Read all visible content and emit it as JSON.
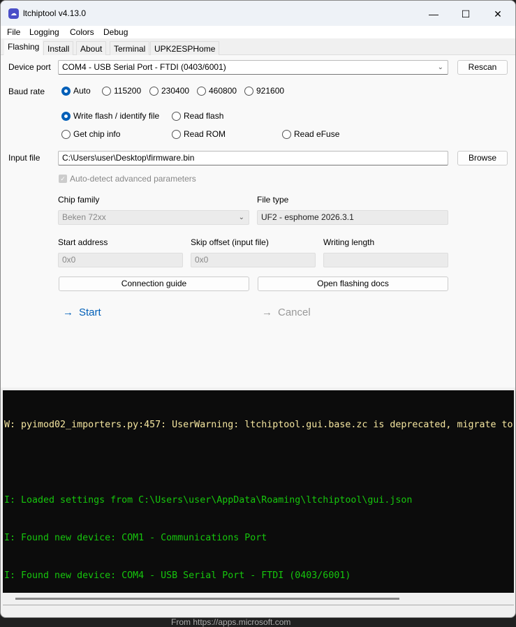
{
  "window": {
    "title": "ltchiptool v4.13.0",
    "minimize": "—",
    "maximize": "☐",
    "close": "✕"
  },
  "menu": [
    "File",
    "Logging",
    "Colors",
    "Debug"
  ],
  "tabs": [
    "Flashing",
    "Install",
    "About",
    "Terminal",
    "UPK2ESPHome"
  ],
  "form": {
    "device_port_label": "Device port",
    "device_port_value": "COM4 - USB Serial Port - FTDI (0403/6001)",
    "rescan": "Rescan",
    "baud_label": "Baud rate",
    "baud_options": [
      "Auto",
      "115200",
      "230400",
      "460800",
      "921600"
    ],
    "baud_selected": "Auto",
    "operations": [
      "Write flash / identify file",
      "Read flash",
      "Get chip info",
      "Read ROM",
      "Read eFuse"
    ],
    "operation_selected": "Write flash / identify file",
    "input_file_label": "Input file",
    "input_file_value": "C:\\Users\\user\\Desktop\\firmware.bin",
    "browse": "Browse",
    "auto_detect": "Auto-detect advanced parameters",
    "auto_detect_checked": true,
    "chip_family_label": "Chip family",
    "chip_family_value": "Beken 72xx",
    "file_type_label": "File type",
    "file_type_value": "UF2 - esphome 2026.3.1",
    "start_address_label": "Start address",
    "start_address_value": "0x0",
    "skip_offset_label": "Skip offset (input file)",
    "skip_offset_value": "0x0",
    "writing_length_label": "Writing length",
    "writing_length_value": "",
    "connection_guide": "Connection guide",
    "flashing_docs": "Open flashing docs",
    "start": "Start",
    "cancel": "Cancel"
  },
  "colors": {
    "accent": "#005fb8",
    "warning": "#f5e6a0",
    "info": "#16c60c"
  },
  "log": [
    {
      "level": "warning",
      "text": "W: pyimod02_importers.py:457: UserWarning: ltchiptool.gui.base.zc is deprecated, migrate to"
    },
    {
      "level": "blank",
      "text": ""
    },
    {
      "level": "info",
      "text": "I: Loaded settings from C:\\Users\\user\\AppData\\Roaming\\ltchiptool\\gui.json"
    },
    {
      "level": "info",
      "text": "I: Found new device: COM1 - Communications Port"
    },
    {
      "level": "info",
      "text": "I: Found new device: COM4 - USB Serial Port - FTDI (0403/6001)"
    }
  ],
  "background_text": "From https://apps.microsoft.com"
}
